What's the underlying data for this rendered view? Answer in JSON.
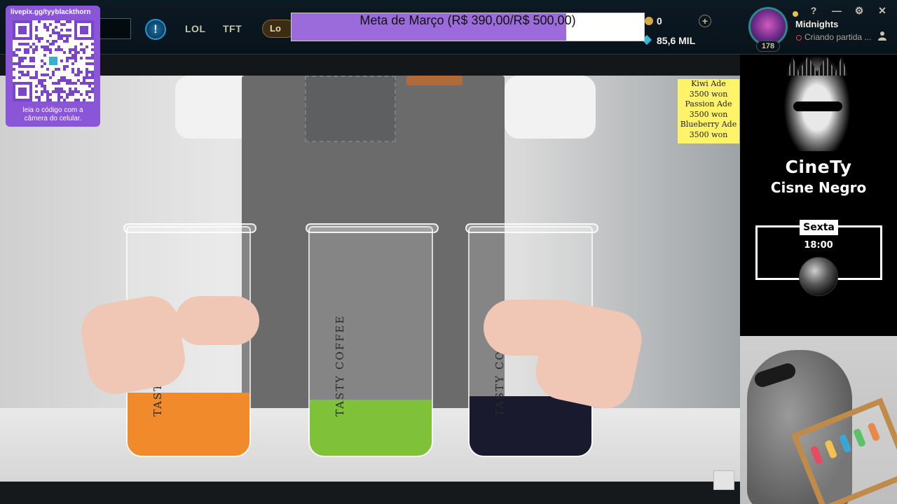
{
  "client": {
    "tabs": [
      "LOL",
      "TFT"
    ],
    "rank_pill_label": "Lo",
    "info_icon": "!",
    "currency": {
      "coins": "0",
      "essence": "85,6 MIL"
    },
    "plus_icon": "+",
    "profile": {
      "name": "Midnights",
      "status": "Criando partida ...",
      "level": "178"
    },
    "window_controls": [
      "?",
      "—",
      "⚙",
      "✕"
    ]
  },
  "goal": {
    "label": "Meta de Março (R$ 390,00/R$ 500,00)",
    "raised": 390,
    "target": 500,
    "fill_color": "#9b6bdc"
  },
  "qr": {
    "url": "livepix.gg/tyyblackthorn",
    "caption_1": "leia o código com a",
    "caption_2": "câmera do celular."
  },
  "video": {
    "price_list": [
      "Kiwi Ade",
      "3500 won",
      "Passion Ade",
      "3500 won",
      "Blueberry Ade",
      "3500 won"
    ],
    "cup_brand": "TASTY COFFEE",
    "cup_colors": [
      "#f08a2a",
      "#7fc23a",
      "#1a1a2e"
    ]
  },
  "schedule": {
    "brand": "CineTy",
    "movie": "Cisne Negro",
    "day": "Sexta",
    "time": "18:00"
  }
}
